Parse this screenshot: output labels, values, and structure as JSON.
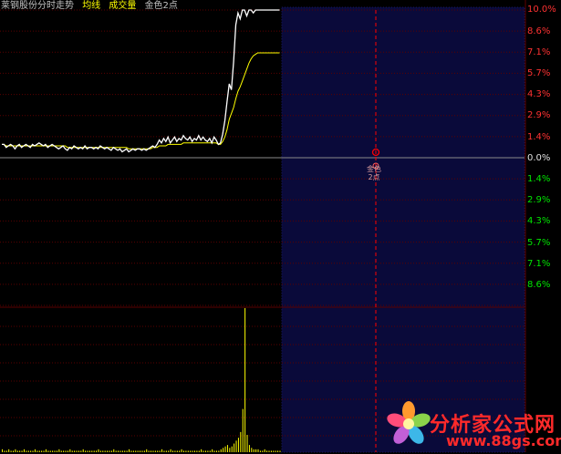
{
  "header": {
    "title": "莱钢股份分时走势",
    "avg_label": "均线",
    "vol_label": "成交量",
    "note": "金色2点"
  },
  "axis": {
    "up_ticks": [
      "10.0%",
      "8.6%",
      "7.1%",
      "5.7%",
      "4.3%",
      "2.9%",
      "1.4%"
    ],
    "zero_tick": "0.0%",
    "down_ticks": [
      "1.4%",
      "2.9%",
      "4.3%",
      "5.7%",
      "7.1%",
      "8.6%"
    ]
  },
  "marker": {
    "line1": "金色",
    "line2": "2点"
  },
  "watermark": {
    "name": "分析家公式网",
    "url": "www.88gs.com"
  },
  "colors": {
    "background": "#000000",
    "price_line": "#ffffff",
    "avg_line": "#ffff00",
    "up_text": "#ff3232",
    "down_text": "#00e600",
    "grid": "#5a0000",
    "volume": "#ffff00",
    "future_area": "#0a0a3a",
    "marker_line": "#ff0000"
  },
  "chart_data": {
    "type": "line",
    "ylim_pct": [
      -10,
      10
    ],
    "series": [
      {
        "name": "",
        "values": [
          0.9,
          0.9,
          0.7,
          0.8,
          0.9,
          0.8,
          0.6,
          0.8,
          0.9,
          0.7,
          0.8,
          0.9,
          0.8,
          0.7,
          0.9,
          0.8,
          0.9,
          1.0,
          0.9,
          0.8,
          0.9,
          0.7,
          0.8,
          0.9,
          0.8,
          0.7,
          0.6,
          0.7,
          0.8,
          0.6,
          0.5,
          0.7,
          0.6,
          0.8,
          0.7,
          0.6,
          0.7,
          0.6,
          0.8,
          0.6,
          0.7,
          0.7,
          0.6,
          0.7,
          0.6,
          0.8,
          0.7,
          0.6,
          0.7,
          0.6,
          0.5,
          0.7,
          0.6,
          0.5,
          0.6,
          0.4,
          0.5,
          0.6,
          0.4,
          0.5,
          0.6,
          0.5,
          0.6,
          0.6,
          0.5,
          0.6,
          0.5,
          0.6,
          0.7,
          0.8,
          0.7,
          0.9,
          1.2,
          1.0,
          1.3,
          1.1,
          1.4,
          1.0,
          1.2,
          1.4,
          1.1,
          1.3,
          1.2,
          1.5,
          1.3,
          1.2,
          1.4,
          1.1,
          1.3,
          1.2,
          1.5,
          1.2,
          1.4,
          1.2,
          1.1,
          1.3,
          1.0,
          1.4,
          1.2,
          0.9,
          1.0,
          1.6,
          2.5,
          3.8,
          5.0,
          4.6,
          6.5,
          9.0,
          9.8,
          9.4,
          10.0,
          10.0,
          9.6,
          10.0,
          10.0,
          9.8,
          10.0,
          10.0,
          10.0,
          10.0,
          10.0,
          10.0,
          10.0,
          10.0,
          10.0,
          10.0,
          10.0,
          10.0
        ]
      },
      {
        "name": "",
        "values": [
          0.9,
          0.9,
          0.8,
          0.8,
          0.8,
          0.8,
          0.8,
          0.8,
          0.8,
          0.8,
          0.8,
          0.8,
          0.8,
          0.8,
          0.8,
          0.8,
          0.8,
          0.8,
          0.8,
          0.8,
          0.8,
          0.8,
          0.8,
          0.8,
          0.8,
          0.8,
          0.8,
          0.8,
          0.8,
          0.8,
          0.7,
          0.7,
          0.7,
          0.7,
          0.7,
          0.7,
          0.7,
          0.7,
          0.7,
          0.7,
          0.7,
          0.7,
          0.7,
          0.7,
          0.7,
          0.7,
          0.7,
          0.7,
          0.7,
          0.7,
          0.7,
          0.7,
          0.7,
          0.7,
          0.7,
          0.7,
          0.7,
          0.7,
          0.6,
          0.6,
          0.6,
          0.6,
          0.6,
          0.6,
          0.6,
          0.6,
          0.6,
          0.6,
          0.6,
          0.7,
          0.7,
          0.7,
          0.8,
          0.8,
          0.8,
          0.8,
          0.9,
          0.9,
          0.9,
          0.9,
          0.9,
          0.9,
          0.9,
          1.0,
          1.0,
          1.0,
          1.0,
          1.0,
          1.0,
          1.0,
          1.0,
          1.0,
          1.0,
          1.0,
          1.0,
          1.0,
          1.0,
          1.0,
          1.0,
          0.9,
          0.9,
          1.1,
          1.4,
          1.9,
          2.6,
          3.0,
          3.4,
          4.0,
          4.5,
          4.8,
          5.2,
          5.6,
          6.0,
          6.4,
          6.7,
          6.9,
          7.0,
          7.1,
          7.1,
          7.1,
          7.1,
          7.1,
          7.1,
          7.1,
          7.1,
          7.1,
          7.1,
          7.1
        ]
      }
    ],
    "volume": [
      2,
      1,
      1,
      2,
      1,
      1,
      2,
      1,
      1,
      1,
      2,
      1,
      1,
      1,
      1,
      2,
      1,
      1,
      1,
      1,
      2,
      1,
      1,
      1,
      1,
      1,
      2,
      1,
      1,
      1,
      1,
      2,
      1,
      1,
      1,
      1,
      1,
      2,
      1,
      1,
      1,
      1,
      1,
      1,
      2,
      1,
      1,
      1,
      1,
      1,
      1,
      2,
      1,
      1,
      1,
      1,
      1,
      1,
      2,
      1,
      1,
      1,
      1,
      1,
      1,
      1,
      2,
      1,
      1,
      1,
      1,
      1,
      1,
      2,
      1,
      1,
      1,
      2,
      1,
      1,
      1,
      1,
      2,
      1,
      1,
      1,
      1,
      1,
      1,
      1,
      1,
      2,
      1,
      1,
      1,
      1,
      2,
      1,
      1,
      1,
      2,
      3,
      4,
      5,
      3,
      4,
      6,
      8,
      10,
      14,
      30,
      100,
      12,
      5,
      3,
      2,
      2,
      2,
      1,
      1,
      2,
      1,
      1,
      1,
      1,
      1,
      1,
      1
    ]
  }
}
